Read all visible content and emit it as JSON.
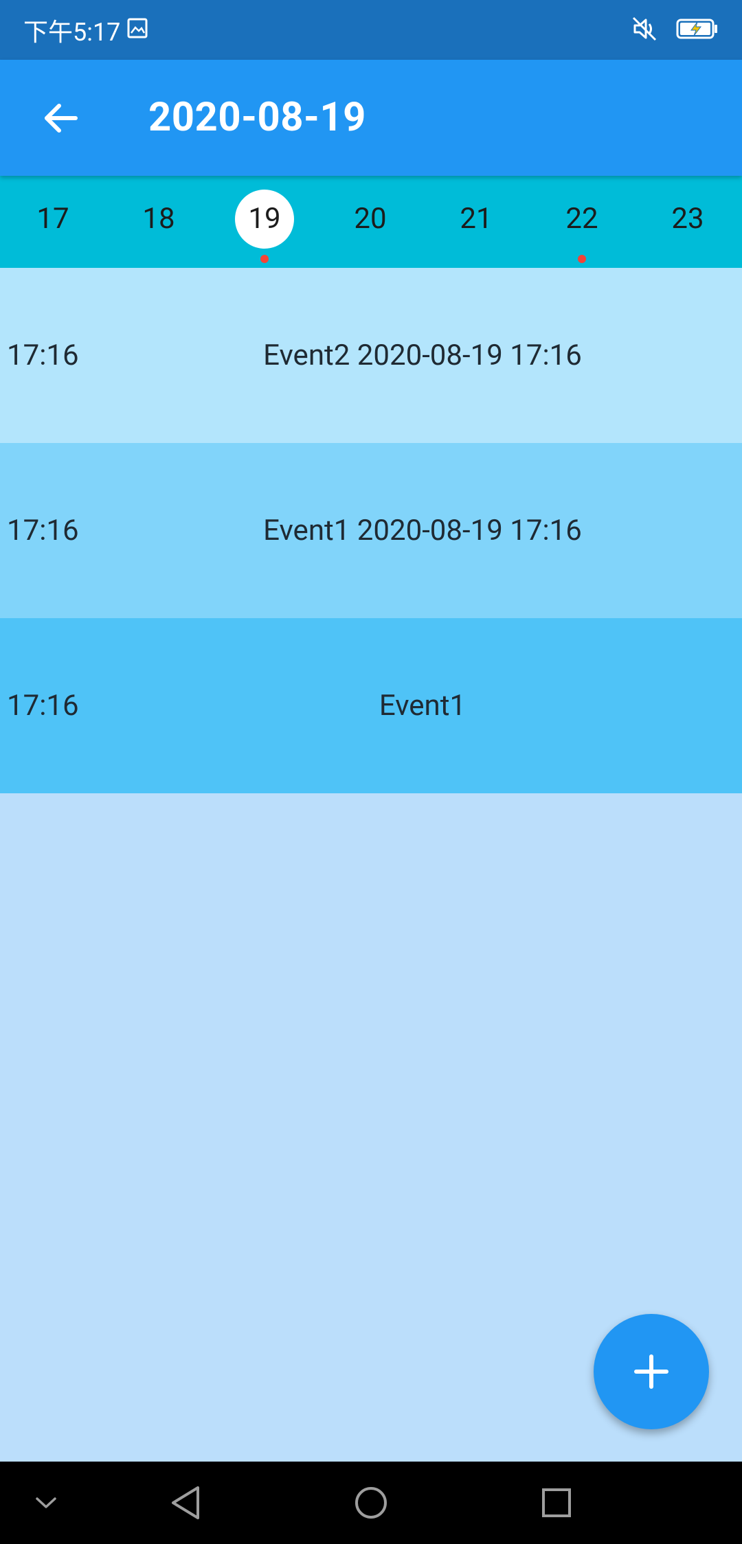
{
  "status_bar": {
    "time": "下午5:17",
    "icons": [
      "gallery-icon",
      "mute-icon",
      "battery-charging-icon"
    ]
  },
  "app_bar": {
    "title": "2020-08-19",
    "back_icon": "arrow-left-icon"
  },
  "week": {
    "days": [
      {
        "label": "17",
        "selected": false,
        "has_event": false
      },
      {
        "label": "18",
        "selected": false,
        "has_event": false
      },
      {
        "label": "19",
        "selected": true,
        "has_event": true
      },
      {
        "label": "20",
        "selected": false,
        "has_event": false
      },
      {
        "label": "21",
        "selected": false,
        "has_event": false
      },
      {
        "label": "22",
        "selected": false,
        "has_event": true
      },
      {
        "label": "23",
        "selected": false,
        "has_event": false
      }
    ]
  },
  "events": [
    {
      "time": "17:16",
      "title": "Event2 2020-08-19 17:16",
      "color": "#b3e5fc"
    },
    {
      "time": "17:16",
      "title": "Event1 2020-08-19 17:16",
      "color": "#81d4fa"
    },
    {
      "time": "17:16",
      "title": "Event1",
      "color": "#4fc3f7"
    }
  ],
  "fab": {
    "icon": "plus-icon"
  },
  "nav_bar": {
    "icons": [
      "chevron-down-icon",
      "back-triangle-icon",
      "home-circle-icon",
      "recents-square-icon"
    ]
  },
  "colors": {
    "status_bar": "#1a70bb",
    "app_bar": "#2196f3",
    "week_strip": "#00bcd8",
    "background": "#bbdefb",
    "event_dot": "#f44336"
  }
}
